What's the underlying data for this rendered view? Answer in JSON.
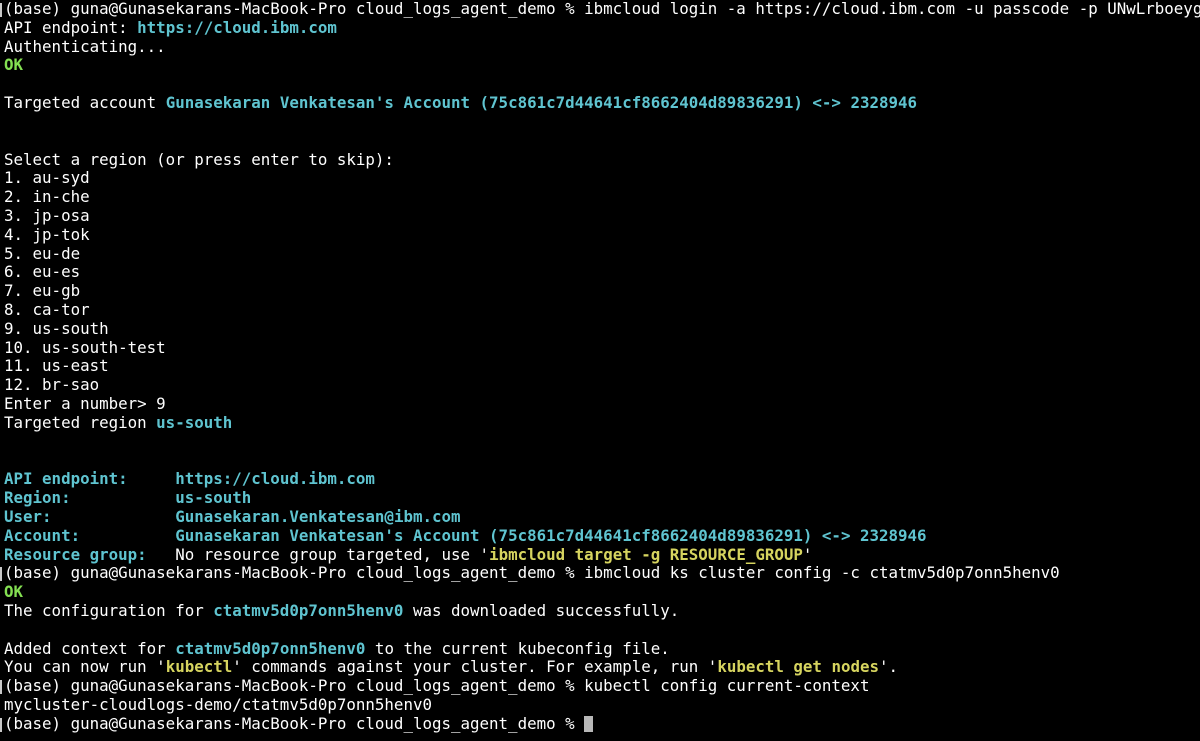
{
  "terminal": {
    "lines": [
      [
        {
          "t": "(base) guna@Gunasekarans-MacBook-Pro cloud_logs_agent_demo % ibmcloud login -a https://cloud.ibm.com -u passcode -p UNwLrboeyg",
          "c": "default"
        }
      ],
      [
        {
          "t": "API endpoint: ",
          "c": "default"
        },
        {
          "t": "https://cloud.ibm.com",
          "c": "cyan"
        }
      ],
      [
        {
          "t": "Authenticating...",
          "c": "default"
        }
      ],
      [
        {
          "t": "OK",
          "c": "green"
        }
      ],
      [],
      [
        {
          "t": "Targeted account ",
          "c": "default"
        },
        {
          "t": "Gunasekaran Venkatesan's Account (75c861c7d44641cf8662404d89836291) <-> 2328946",
          "c": "cyan"
        }
      ],
      [],
      [],
      [
        {
          "t": "Select a region (or press enter to skip):",
          "c": "default"
        }
      ],
      [
        {
          "t": "1. au-syd",
          "c": "default"
        }
      ],
      [
        {
          "t": "2. in-che",
          "c": "default"
        }
      ],
      [
        {
          "t": "3. jp-osa",
          "c": "default"
        }
      ],
      [
        {
          "t": "4. jp-tok",
          "c": "default"
        }
      ],
      [
        {
          "t": "5. eu-de",
          "c": "default"
        }
      ],
      [
        {
          "t": "6. eu-es",
          "c": "default"
        }
      ],
      [
        {
          "t": "7. eu-gb",
          "c": "default"
        }
      ],
      [
        {
          "t": "8. ca-tor",
          "c": "default"
        }
      ],
      [
        {
          "t": "9. us-south",
          "c": "default"
        }
      ],
      [
        {
          "t": "10. us-south-test",
          "c": "default"
        }
      ],
      [
        {
          "t": "11. us-east",
          "c": "default"
        }
      ],
      [
        {
          "t": "12. br-sao",
          "c": "default"
        }
      ],
      [
        {
          "t": "Enter a number> 9",
          "c": "default"
        }
      ],
      [
        {
          "t": "Targeted region ",
          "c": "default"
        },
        {
          "t": "us-south",
          "c": "cyan"
        }
      ],
      [],
      [],
      [
        {
          "t": "API endpoint:     ",
          "c": "cyan"
        },
        {
          "t": "https://cloud.ibm.com",
          "c": "cyan"
        }
      ],
      [
        {
          "t": "Region:           ",
          "c": "cyan"
        },
        {
          "t": "us-south",
          "c": "cyan"
        }
      ],
      [
        {
          "t": "User:             ",
          "c": "cyan"
        },
        {
          "t": "Gunasekaran.Venkatesan@ibm.com",
          "c": "cyan"
        }
      ],
      [
        {
          "t": "Account:          ",
          "c": "cyan"
        },
        {
          "t": "Gunasekaran Venkatesan's Account (75c861c7d44641cf8662404d89836291) <-> 2328946",
          "c": "cyan"
        }
      ],
      [
        {
          "t": "Resource group:   ",
          "c": "cyan"
        },
        {
          "t": "No resource group targeted, use '",
          "c": "default"
        },
        {
          "t": "ibmcloud target -g RESOURCE_GROUP",
          "c": "yellow"
        },
        {
          "t": "'",
          "c": "default"
        }
      ],
      [
        {
          "t": "(base) guna@Gunasekarans-MacBook-Pro cloud_logs_agent_demo % ibmcloud ks cluster config -c ctatmv5d0p7onn5henv0",
          "c": "default"
        }
      ],
      [
        {
          "t": "OK",
          "c": "green"
        }
      ],
      [
        {
          "t": "The configuration for ",
          "c": "default"
        },
        {
          "t": "ctatmv5d0p7onn5henv0",
          "c": "cyan"
        },
        {
          "t": " was downloaded successfully.",
          "c": "default"
        }
      ],
      [],
      [
        {
          "t": "Added context for ",
          "c": "default"
        },
        {
          "t": "ctatmv5d0p7onn5henv0",
          "c": "cyan"
        },
        {
          "t": " to the current kubeconfig file.",
          "c": "default"
        }
      ],
      [
        {
          "t": "You can now run '",
          "c": "default"
        },
        {
          "t": "kubectl",
          "c": "yellow"
        },
        {
          "t": "' commands against your cluster. For example, run '",
          "c": "default"
        },
        {
          "t": "kubectl get nodes",
          "c": "yellow"
        },
        {
          "t": "'.",
          "c": "default"
        }
      ],
      [
        {
          "t": "(base) guna@Gunasekarans-MacBook-Pro cloud_logs_agent_demo % kubectl config current-context",
          "c": "default"
        }
      ],
      [
        {
          "t": "mycluster-cloudlogs-demo/ctatmv5d0p7onn5henv0",
          "c": "default"
        }
      ],
      [
        {
          "t": "(base) guna@Gunasekarans-MacBook-Pro cloud_logs_agent_demo % ",
          "c": "default"
        }
      ]
    ],
    "prompt_line_indices": [
      0,
      30,
      36,
      38
    ],
    "cursor_line_index": 38
  },
  "colors": {
    "background": "#000000",
    "default": "#ffffff",
    "cyan": "#5fc4d0",
    "green": "#84e052",
    "yellow": "#d6d45f"
  }
}
